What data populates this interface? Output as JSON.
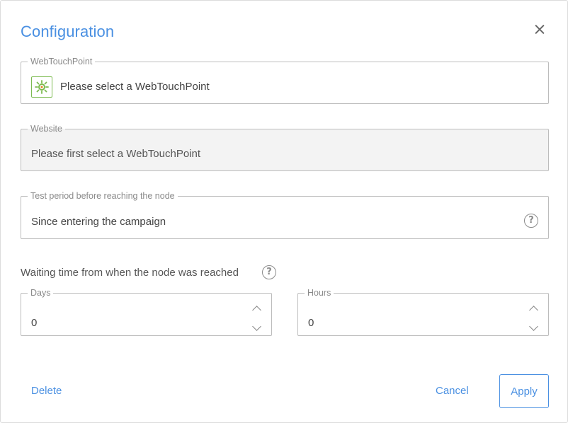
{
  "dialog": {
    "title": "Configuration",
    "close_icon": "close-icon"
  },
  "webtouchpoint": {
    "label": "WebTouchPoint",
    "value": "Please select a WebTouchPoint",
    "icon": "webtouchpoint-icon",
    "accent_color": "#7dbb52"
  },
  "website": {
    "label": "Website",
    "value": "Please first select a WebTouchPoint"
  },
  "test_period": {
    "label": "Test period before reaching the node",
    "value": "Since entering the campaign",
    "help_icon": "help-icon"
  },
  "waiting": {
    "label": "Waiting time from when the node was reached",
    "help_icon": "help-icon",
    "days": {
      "label": "Days",
      "value": "0"
    },
    "hours": {
      "label": "Hours",
      "value": "0"
    }
  },
  "footer": {
    "delete_label": "Delete",
    "cancel_label": "Cancel",
    "apply_label": "Apply"
  },
  "colors": {
    "accent": "#4a90e2",
    "border": "#bcbcbc",
    "disabled_bg": "#f3f3f3"
  }
}
